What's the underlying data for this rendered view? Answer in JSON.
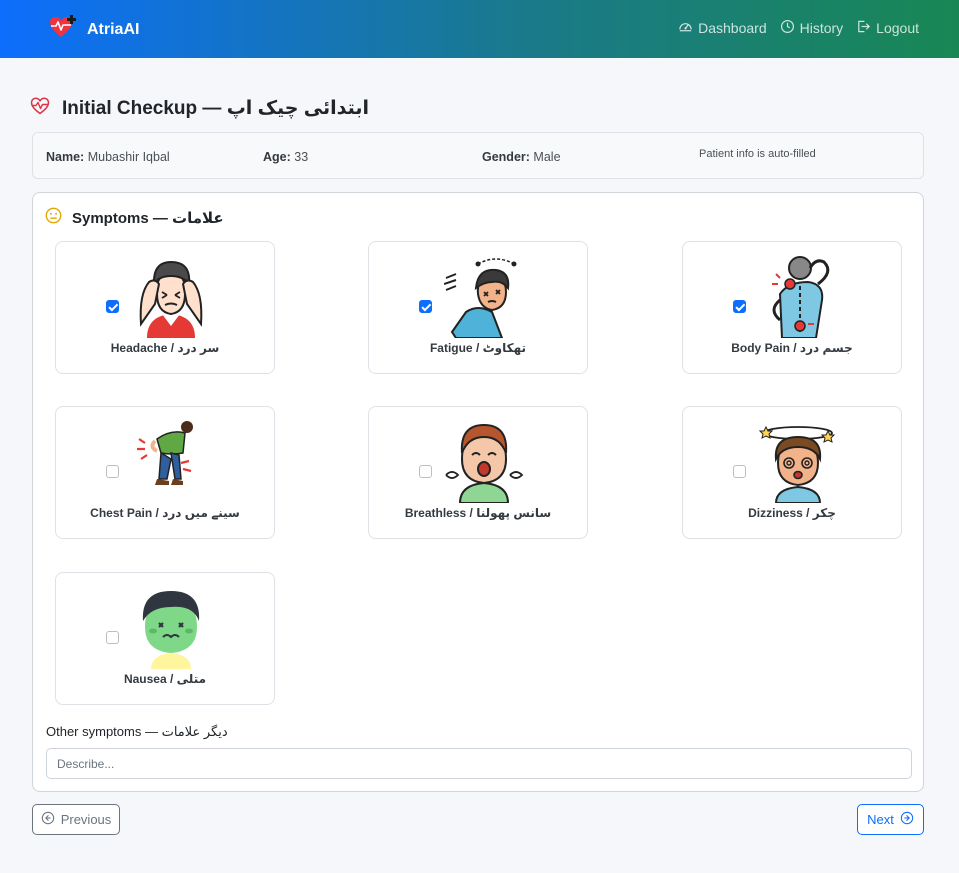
{
  "app": {
    "brand": "AtriaAI"
  },
  "nav": {
    "dashboard": "Dashboard",
    "history": "History",
    "logout": "Logout"
  },
  "page": {
    "title": "Initial Checkup — ابتدائی چیک اپ"
  },
  "patient": {
    "name_label": "Name:",
    "name": "Mubashir Iqbal",
    "age_label": "Age:",
    "age": "33",
    "gender_label": "Gender:",
    "gender": "Male",
    "note": "Patient info is auto-filled"
  },
  "symptoms": {
    "title": "Symptoms — علامات",
    "items": [
      {
        "label": "Headache / سر درد",
        "checked": true,
        "icon": "headache-icon"
      },
      {
        "label": "Fatigue / تھکاوٹ",
        "checked": true,
        "icon": "fatigue-icon"
      },
      {
        "label": "Body Pain / جسم درد",
        "checked": true,
        "icon": "body-pain-icon"
      },
      {
        "label": "Chest Pain / سینے میں درد",
        "checked": false,
        "icon": "chest-pain-icon"
      },
      {
        "label": "Breathless / سانس پھولنا",
        "checked": false,
        "icon": "breathless-icon"
      },
      {
        "label": "Dizziness / چکر",
        "checked": false,
        "icon": "dizziness-icon"
      },
      {
        "label": "Nausea / متلی",
        "checked": false,
        "icon": "nausea-icon"
      }
    ],
    "other_label": "Other symptoms — دیگر علامات",
    "other_placeholder": "Describe...",
    "other_value": ""
  },
  "buttons": {
    "previous": "Previous",
    "next": "Next"
  },
  "colors": {
    "primary": "#0d6efd",
    "nav_start": "#0d6efd",
    "nav_end": "#198754",
    "heart": "#dc3545",
    "warning": "#ffc107"
  }
}
